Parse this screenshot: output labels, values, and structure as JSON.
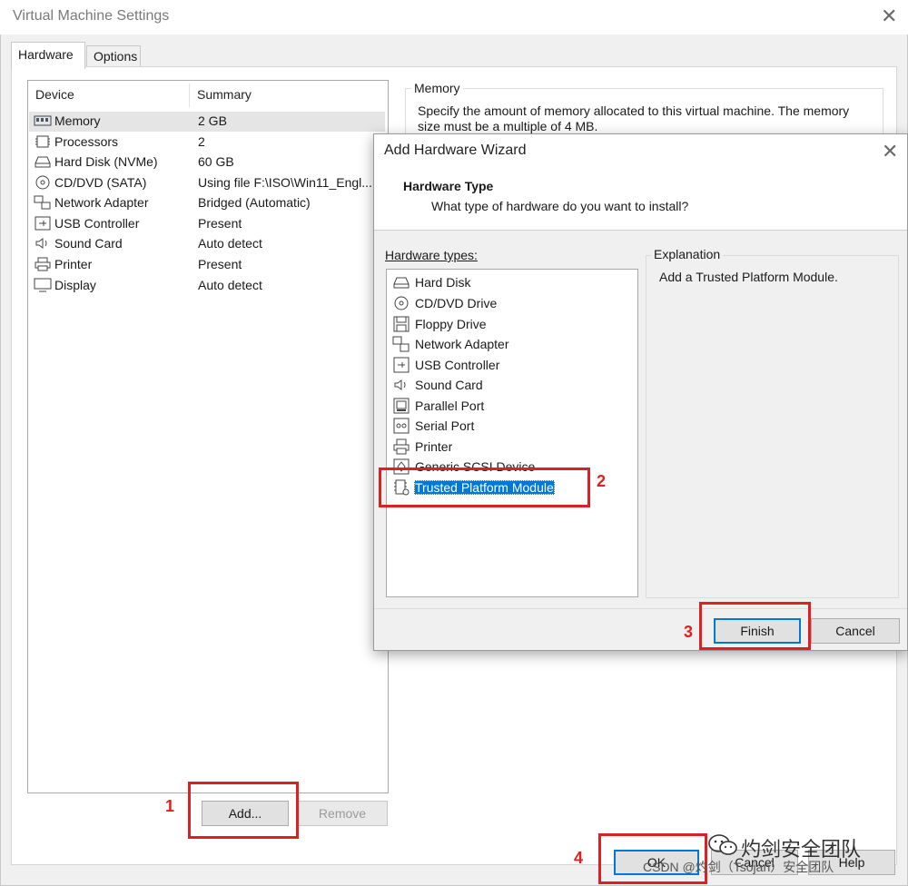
{
  "main": {
    "title": "Virtual Machine Settings",
    "tabs": [
      {
        "label": "Hardware"
      },
      {
        "label": "Options"
      }
    ],
    "columns": {
      "device": "Device",
      "summary": "Summary"
    },
    "devices": [
      {
        "icon": "memory-icon",
        "name": "Memory",
        "summary": "2 GB"
      },
      {
        "icon": "processor-icon",
        "name": "Processors",
        "summary": "2"
      },
      {
        "icon": "hard-disk-icon",
        "name": "Hard Disk (NVMe)",
        "summary": "60 GB"
      },
      {
        "icon": "cd-dvd-icon",
        "name": "CD/DVD (SATA)",
        "summary": "Using file F:\\ISO\\Win11_Engl..."
      },
      {
        "icon": "network-adapter-icon",
        "name": "Network Adapter",
        "summary": "Bridged (Automatic)"
      },
      {
        "icon": "usb-icon",
        "name": "USB Controller",
        "summary": "Present"
      },
      {
        "icon": "sound-icon",
        "name": "Sound Card",
        "summary": "Auto detect"
      },
      {
        "icon": "printer-icon",
        "name": "Printer",
        "summary": "Present"
      },
      {
        "icon": "display-icon",
        "name": "Display",
        "summary": "Auto detect"
      }
    ],
    "add_label": "Add...",
    "remove_label": "Remove",
    "memory_group": {
      "label": "Memory",
      "text_line1": "Specify the amount of memory allocated to this virtual machine. The memory",
      "text_line2": "size must be a multiple of 4 MB."
    },
    "ok_label": "OK",
    "cancel_label": "Cancel",
    "help_label": "Help"
  },
  "wizard": {
    "title": "Add Hardware Wizard",
    "heading": "Hardware Type",
    "subheading": "What type of hardware do you want to install?",
    "hardware_types_label": "Hardware types:",
    "items": [
      {
        "icon": "hard-disk-icon",
        "label": "Hard Disk"
      },
      {
        "icon": "cd-dvd-icon",
        "label": "CD/DVD Drive"
      },
      {
        "icon": "floppy-icon",
        "label": "Floppy Drive"
      },
      {
        "icon": "network-adapter-icon",
        "label": "Network Adapter"
      },
      {
        "icon": "usb-icon",
        "label": "USB Controller"
      },
      {
        "icon": "sound-icon",
        "label": "Sound Card"
      },
      {
        "icon": "parallel-port-icon",
        "label": "Parallel Port"
      },
      {
        "icon": "serial-port-icon",
        "label": "Serial Port"
      },
      {
        "icon": "printer-icon",
        "label": "Printer"
      },
      {
        "icon": "generic-scsi-icon",
        "label": "Generic SCSI Device"
      },
      {
        "icon": "tpm-icon",
        "label": "Trusted Platform Module",
        "selected": true
      }
    ],
    "explanation_label": "Explanation",
    "explanation_text": "Add a Trusted Platform Module.",
    "finish_label": "Finish",
    "cancel_label": "Cancel"
  },
  "annotations": {
    "n1": "1",
    "n2": "2",
    "n3": "3",
    "n4": "4"
  },
  "watermark": {
    "line1": "灼剑安全团队",
    "line2": "CSDN @灼剑（Tsojan）安全团队"
  },
  "colors": {
    "accent": "#0078d7",
    "annotation": "#e02020",
    "selection": "#0078d7"
  }
}
